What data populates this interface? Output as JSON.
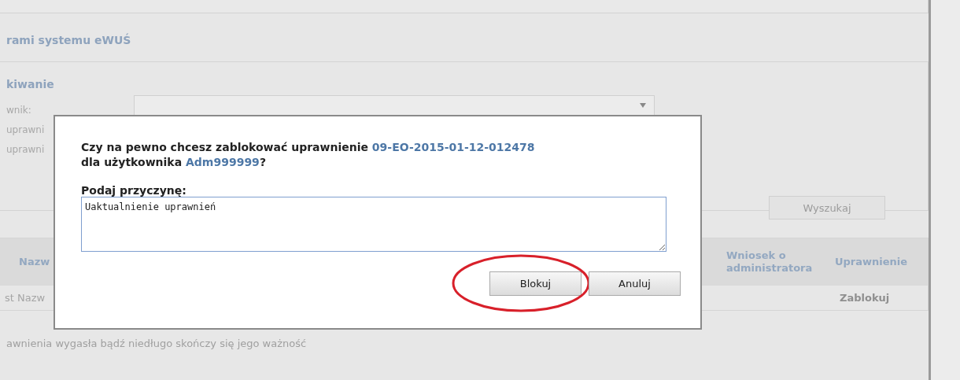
{
  "page": {
    "heading": "rami systemu eWUŚ"
  },
  "search": {
    "title": "kiwanie",
    "labels": [
      "wnik:",
      "uprawni",
      "uprawni"
    ],
    "button": "Wyszukaj"
  },
  "table": {
    "columns": [
      "Nazw",
      "Wniosek o administratora",
      "Uprawnienie"
    ],
    "rows": [
      {
        "name": "st Nazw",
        "action": "Zablokuj"
      }
    ]
  },
  "footer_note": "awnienia wygasła bądź niedługo skończy się jego ważność",
  "dialog": {
    "message": {
      "before": "Czy na pewno chcesz zablokować uprawnienie",
      "permission": "09-EO-2015-01-12-012478",
      "middle": "dla użytkownika",
      "user": "Adm999999",
      "end": "?"
    },
    "reason_label": "Podaj przyczynę:",
    "reason_value": "Uaktualnienie uprawnień",
    "buttons": [
      {
        "label": "Blokuj",
        "highlighted": true
      },
      {
        "label": "Anuluj",
        "highlighted": false
      }
    ]
  }
}
